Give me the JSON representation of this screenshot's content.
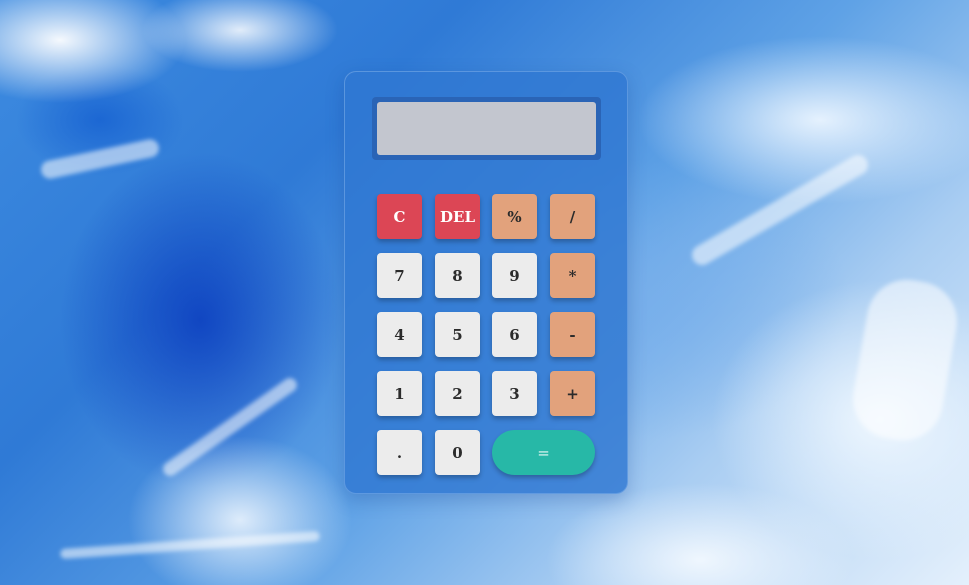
{
  "display": {
    "value": ""
  },
  "keys": {
    "clear": "C",
    "del": "DEL",
    "percent": "%",
    "divide": "/",
    "seven": "7",
    "eight": "8",
    "nine": "9",
    "multiply": "*",
    "four": "4",
    "five": "5",
    "six": "6",
    "minus": "-",
    "one": "1",
    "two": "2",
    "three": "3",
    "plus": "+",
    "dot": ".",
    "zero": "0",
    "equals": "="
  },
  "colors": {
    "panel": "#3078d2",
    "display_bg": "#c3c6cf",
    "key_default": "#ececec",
    "key_red": "#dc4655",
    "key_orange": "#e2a27c",
    "key_equals": "#27b8a7"
  }
}
